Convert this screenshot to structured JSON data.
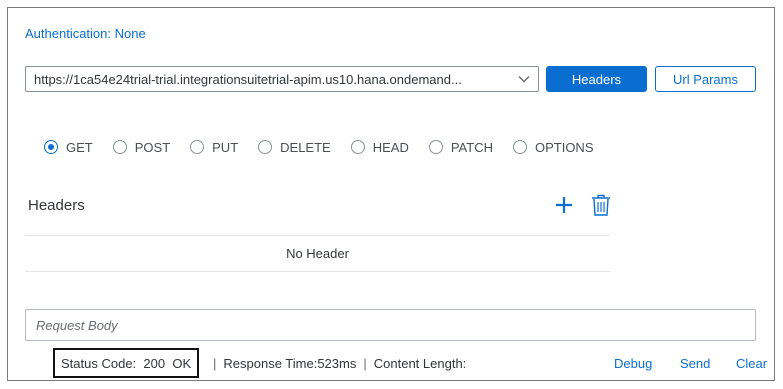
{
  "auth": {
    "label": "Authentication: None"
  },
  "url": {
    "value": "https://1ca54e24trial-trial.integrationsuitetrial-apim.us10.hana.ondemand..."
  },
  "buttons": {
    "headers": "Headers",
    "url_params": "Url Params"
  },
  "methods": [
    "GET",
    "POST",
    "PUT",
    "DELETE",
    "HEAD",
    "PATCH",
    "OPTIONS"
  ],
  "selected_method": "GET",
  "headers_section": {
    "title": "Headers",
    "empty_text": "No Header"
  },
  "request_body": {
    "placeholder": "Request Body"
  },
  "status": {
    "code_label": "Status Code:",
    "code": "200",
    "text": "OK",
    "response_time_label": "Response Time:",
    "response_time": "523",
    "response_time_unit": "ms",
    "content_length_label": "Content Length:"
  },
  "actions": {
    "debug": "Debug",
    "send": "Send",
    "clear": "Clear"
  },
  "colors": {
    "accent": "#0a6ed1",
    "text": "#32363a"
  },
  "icons": {
    "dropdown": "chevron-down-icon",
    "add": "plus-icon",
    "delete": "trash-icon",
    "radio": "radio-icon"
  }
}
